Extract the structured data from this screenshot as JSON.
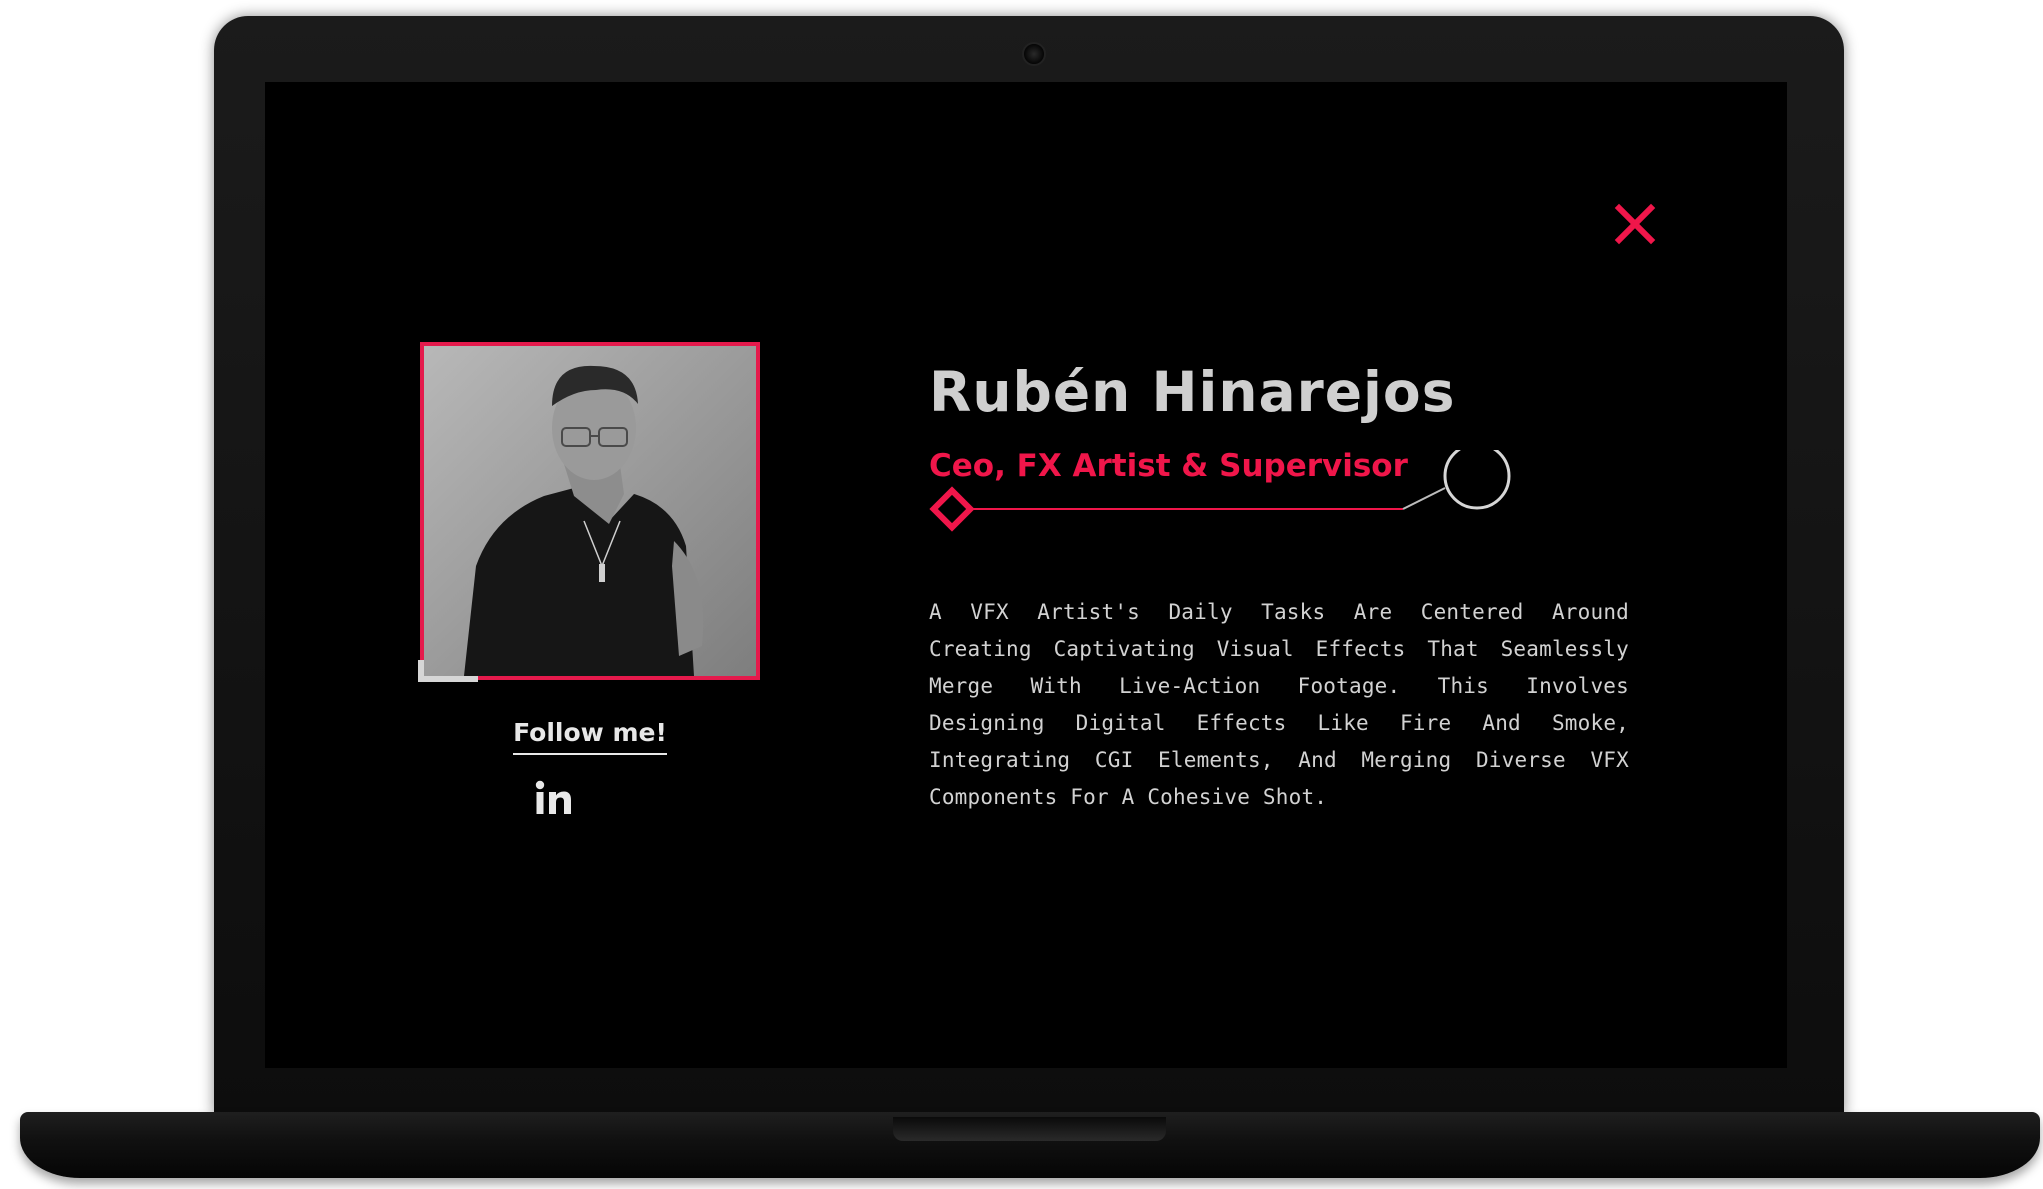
{
  "profile": {
    "name": "Rubén Hinarejos",
    "role": "Ceo, FX Artist & Supervisor",
    "bio": "A VFX Artist's Daily Tasks Are Centered Around Creating Captivating Visual Effects That Seamlessly Merge With Live-Action Footage. This Involves Designing Digital Effects Like Fire And Smoke, Integrating CGI Elements, And Merging Diverse VFX Components For A Cohesive Shot."
  },
  "social": {
    "follow_label": "Follow me!",
    "icons": [
      "linkedin-icon"
    ]
  },
  "icons": {
    "close": "close-icon",
    "linkedin": "linkedin-icon"
  },
  "colors": {
    "accent": "#f0164a",
    "background": "#000000",
    "text": "#cfcfcf"
  }
}
